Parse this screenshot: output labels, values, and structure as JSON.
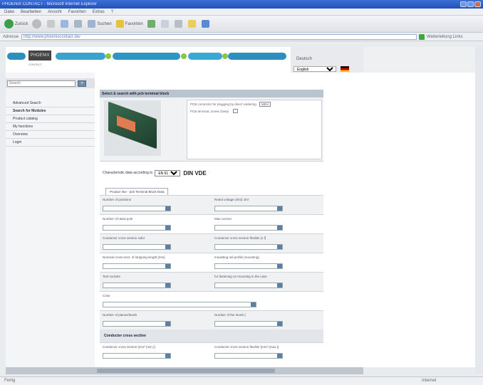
{
  "browser": {
    "title": "PHOENIX CONTACT - Microsoft Internet Explorer",
    "menu": [
      "Datei",
      "Bearbeiten",
      "Ansicht",
      "Favoriten",
      "Extras",
      "?"
    ],
    "toolbar": {
      "back": "Zurück",
      "search": "Suchen",
      "favorites": "Favoriten"
    },
    "address_label": "Adresse",
    "url": "http://www.phoenixcontact.de/",
    "links_label": "Weiterleitung  Links"
  },
  "header": {
    "logo_text": "PHOENIX",
    "logo_sub": "CONTACT",
    "country_label": "Deutsch",
    "language_select": "English"
  },
  "sidebar": {
    "search_placeholder": "Search",
    "search_button": "»",
    "items": [
      {
        "label": "Advanced Search"
      },
      {
        "label": "Search for Modules"
      },
      {
        "label": "Product catalog"
      },
      {
        "label": "My functions"
      },
      {
        "label": "Overview"
      },
      {
        "label": "Login"
      }
    ]
  },
  "main": {
    "form_header": "Select & search with pcb terminal block",
    "product_options": [
      {
        "label": "PCB connector for plugging by direct soldering",
        "value": "MBN"
      },
      {
        "label": "PCB terminal, screw clamp",
        "value": ""
      }
    ],
    "selector_label": "Characteristic data according to",
    "selector_value": "EN 61984",
    "selector_code": "DIN VDE",
    "tabs": [
      "Product line - pcb Terminal Block-Data"
    ],
    "fields": [
      [
        "Number of positions",
        "Rated voltage (III/3) 1kV"
      ],
      [
        "Number of rated pole",
        "Max.current"
      ],
      [
        "Conductor cross section solid",
        "Conductor cross section flexible [1 f]"
      ],
      [
        "Nominal cross-sect. of stripping length [mm]",
        "Insulating rail profile (mounting)"
      ],
      [
        "Test sockets",
        "for fastening on mounting in the case"
      ],
      [
        "Color"
      ],
      [
        "Number of planes/levels",
        "Number of the levels ["
      ]
    ],
    "section_title": "Conductor cross section",
    "section_fields": [
      "Conductor cross section [mm² (min.)]",
      "Conductor cross section flexible [mm² (max.)]"
    ]
  },
  "status": {
    "done": "Fertig",
    "zone": "Internet"
  }
}
